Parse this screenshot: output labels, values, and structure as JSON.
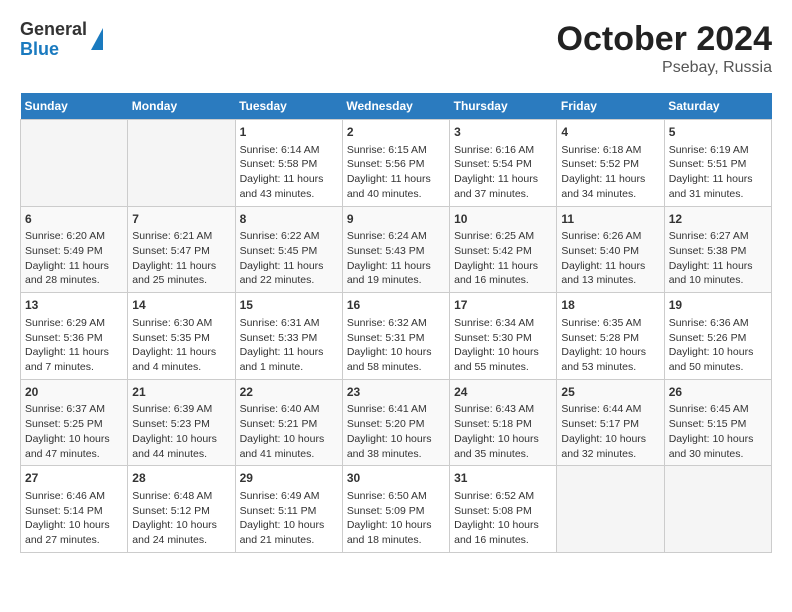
{
  "logo": {
    "line1": "General",
    "line2": "Blue"
  },
  "title": "October 2024",
  "subtitle": "Psebay, Russia",
  "days_of_week": [
    "Sunday",
    "Monday",
    "Tuesday",
    "Wednesday",
    "Thursday",
    "Friday",
    "Saturday"
  ],
  "weeks": [
    [
      {
        "day": "",
        "info": ""
      },
      {
        "day": "",
        "info": ""
      },
      {
        "day": "1",
        "info": "Sunrise: 6:14 AM\nSunset: 5:58 PM\nDaylight: 11 hours and 43 minutes."
      },
      {
        "day": "2",
        "info": "Sunrise: 6:15 AM\nSunset: 5:56 PM\nDaylight: 11 hours and 40 minutes."
      },
      {
        "day": "3",
        "info": "Sunrise: 6:16 AM\nSunset: 5:54 PM\nDaylight: 11 hours and 37 minutes."
      },
      {
        "day": "4",
        "info": "Sunrise: 6:18 AM\nSunset: 5:52 PM\nDaylight: 11 hours and 34 minutes."
      },
      {
        "day": "5",
        "info": "Sunrise: 6:19 AM\nSunset: 5:51 PM\nDaylight: 11 hours and 31 minutes."
      }
    ],
    [
      {
        "day": "6",
        "info": "Sunrise: 6:20 AM\nSunset: 5:49 PM\nDaylight: 11 hours and 28 minutes."
      },
      {
        "day": "7",
        "info": "Sunrise: 6:21 AM\nSunset: 5:47 PM\nDaylight: 11 hours and 25 minutes."
      },
      {
        "day": "8",
        "info": "Sunrise: 6:22 AM\nSunset: 5:45 PM\nDaylight: 11 hours and 22 minutes."
      },
      {
        "day": "9",
        "info": "Sunrise: 6:24 AM\nSunset: 5:43 PM\nDaylight: 11 hours and 19 minutes."
      },
      {
        "day": "10",
        "info": "Sunrise: 6:25 AM\nSunset: 5:42 PM\nDaylight: 11 hours and 16 minutes."
      },
      {
        "day": "11",
        "info": "Sunrise: 6:26 AM\nSunset: 5:40 PM\nDaylight: 11 hours and 13 minutes."
      },
      {
        "day": "12",
        "info": "Sunrise: 6:27 AM\nSunset: 5:38 PM\nDaylight: 11 hours and 10 minutes."
      }
    ],
    [
      {
        "day": "13",
        "info": "Sunrise: 6:29 AM\nSunset: 5:36 PM\nDaylight: 11 hours and 7 minutes."
      },
      {
        "day": "14",
        "info": "Sunrise: 6:30 AM\nSunset: 5:35 PM\nDaylight: 11 hours and 4 minutes."
      },
      {
        "day": "15",
        "info": "Sunrise: 6:31 AM\nSunset: 5:33 PM\nDaylight: 11 hours and 1 minute."
      },
      {
        "day": "16",
        "info": "Sunrise: 6:32 AM\nSunset: 5:31 PM\nDaylight: 10 hours and 58 minutes."
      },
      {
        "day": "17",
        "info": "Sunrise: 6:34 AM\nSunset: 5:30 PM\nDaylight: 10 hours and 55 minutes."
      },
      {
        "day": "18",
        "info": "Sunrise: 6:35 AM\nSunset: 5:28 PM\nDaylight: 10 hours and 53 minutes."
      },
      {
        "day": "19",
        "info": "Sunrise: 6:36 AM\nSunset: 5:26 PM\nDaylight: 10 hours and 50 minutes."
      }
    ],
    [
      {
        "day": "20",
        "info": "Sunrise: 6:37 AM\nSunset: 5:25 PM\nDaylight: 10 hours and 47 minutes."
      },
      {
        "day": "21",
        "info": "Sunrise: 6:39 AM\nSunset: 5:23 PM\nDaylight: 10 hours and 44 minutes."
      },
      {
        "day": "22",
        "info": "Sunrise: 6:40 AM\nSunset: 5:21 PM\nDaylight: 10 hours and 41 minutes."
      },
      {
        "day": "23",
        "info": "Sunrise: 6:41 AM\nSunset: 5:20 PM\nDaylight: 10 hours and 38 minutes."
      },
      {
        "day": "24",
        "info": "Sunrise: 6:43 AM\nSunset: 5:18 PM\nDaylight: 10 hours and 35 minutes."
      },
      {
        "day": "25",
        "info": "Sunrise: 6:44 AM\nSunset: 5:17 PM\nDaylight: 10 hours and 32 minutes."
      },
      {
        "day": "26",
        "info": "Sunrise: 6:45 AM\nSunset: 5:15 PM\nDaylight: 10 hours and 30 minutes."
      }
    ],
    [
      {
        "day": "27",
        "info": "Sunrise: 6:46 AM\nSunset: 5:14 PM\nDaylight: 10 hours and 27 minutes."
      },
      {
        "day": "28",
        "info": "Sunrise: 6:48 AM\nSunset: 5:12 PM\nDaylight: 10 hours and 24 minutes."
      },
      {
        "day": "29",
        "info": "Sunrise: 6:49 AM\nSunset: 5:11 PM\nDaylight: 10 hours and 21 minutes."
      },
      {
        "day": "30",
        "info": "Sunrise: 6:50 AM\nSunset: 5:09 PM\nDaylight: 10 hours and 18 minutes."
      },
      {
        "day": "31",
        "info": "Sunrise: 6:52 AM\nSunset: 5:08 PM\nDaylight: 10 hours and 16 minutes."
      },
      {
        "day": "",
        "info": ""
      },
      {
        "day": "",
        "info": ""
      }
    ]
  ]
}
